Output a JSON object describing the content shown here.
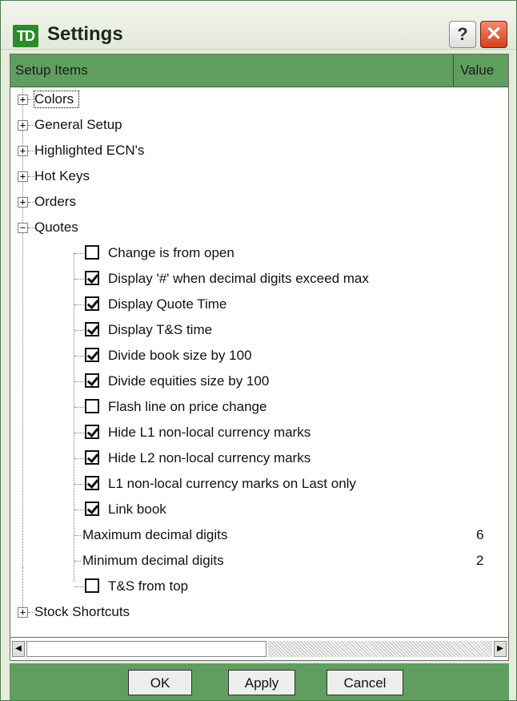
{
  "window": {
    "logo_text": "TD",
    "title": "Settings",
    "help_label": "?",
    "close_label": "✕"
  },
  "table": {
    "col_setup": "Setup Items",
    "col_value": "Value"
  },
  "tree": {
    "colors": "Colors",
    "general_setup": "General Setup",
    "highlighted_ecns": "Highlighted ECN's",
    "hot_keys": "Hot Keys",
    "orders": "Orders",
    "quotes": "Quotes",
    "stock_shortcuts": "Stock Shortcuts",
    "quote_items": [
      {
        "label": "Change is from open",
        "checked": false
      },
      {
        "label": "Display '#' when decimal digits exceed max",
        "checked": true
      },
      {
        "label": "Display Quote Time",
        "checked": true
      },
      {
        "label": "Display T&S time",
        "checked": true
      },
      {
        "label": "Divide book size by 100",
        "checked": true
      },
      {
        "label": "Divide equities size by 100",
        "checked": true
      },
      {
        "label": "Flash line on price change",
        "checked": false
      },
      {
        "label": "Hide L1 non-local currency marks",
        "checked": true
      },
      {
        "label": "Hide L2 non-local currency marks",
        "checked": true
      },
      {
        "label": "L1 non-local currency marks on Last only",
        "checked": true
      },
      {
        "label": "Link book",
        "checked": true
      },
      {
        "label": "Maximum decimal digits",
        "value": "6"
      },
      {
        "label": "Minimum decimal digits",
        "value": "2"
      },
      {
        "label": "T&S from top",
        "checked": false
      }
    ]
  },
  "scroll": {
    "left_arrow": "◀",
    "right_arrow": "▶"
  },
  "buttons": {
    "ok": "OK",
    "apply": "Apply",
    "cancel": "Cancel"
  },
  "colors": {
    "brand_green": "#2a8b2a",
    "header_green": "#5f9e5f",
    "close_red": "#d2401e"
  }
}
